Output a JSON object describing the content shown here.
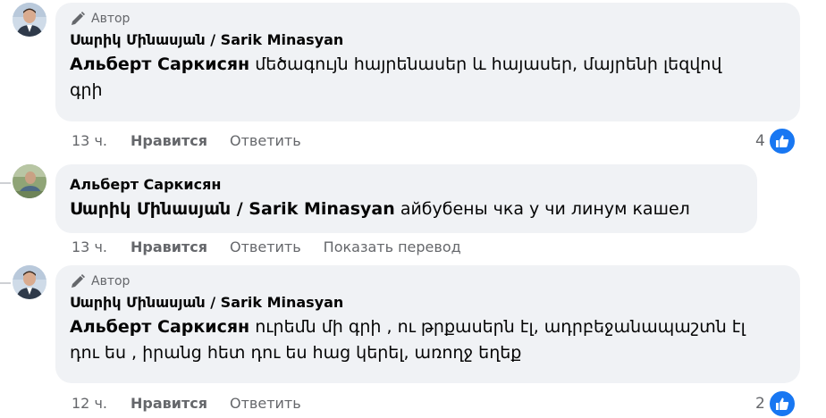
{
  "comments": [
    {
      "author_tag": "Автор",
      "name": "Սարիկ Մինասյան / Sarik Minasyan",
      "mention": "Альберт Саркисян",
      "text_first_line": "մեծագույն հայրենասեր և հայասեր, մայրենի լեզվով",
      "text_second_line": "գրի",
      "time": "13 ч.",
      "like": "Нравится",
      "reply": "Ответить",
      "reaction_count": "4"
    },
    {
      "name": "Альберт Саркисян",
      "mention": "Սարիկ Մինասյան / Sarik Minasyan",
      "text": "айбубены чка у чи линум кашел",
      "time": "13 ч.",
      "like": "Нравится",
      "reply": "Ответить",
      "translate": "Показать перевод"
    },
    {
      "author_tag": "Автор",
      "name": "Սարիկ Մինասյան / Sarik Minasyan",
      "mention": "Альберт Саркисян",
      "text_first_line": "ուրեմն մի գրի , ու թրքասերն էլ, ադրբեջանապաշտն էլ",
      "text_second_line": "դու ես , իրանց հետ դու ես հաց կերել, առողջ եղեք",
      "time": "12 ч.",
      "like": "Нравится",
      "reply": "Ответить",
      "reaction_count": "2"
    }
  ],
  "colors": {
    "bubble": "#f0f2f5",
    "meta_text": "#65676b",
    "like_blue": "#1877f2"
  },
  "icons": [
    "pencil-icon",
    "like-icon",
    "avatar"
  ]
}
